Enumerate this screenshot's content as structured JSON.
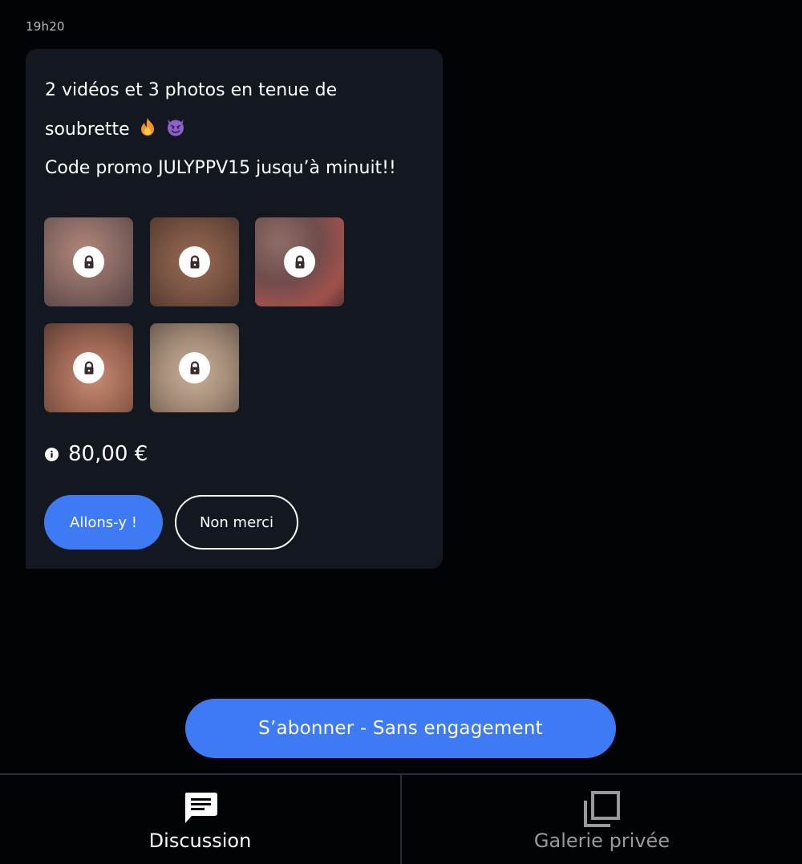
{
  "chat": {
    "timestamp": "19h20",
    "message": {
      "line1": "2 vidéos et 3 photos en tenue de",
      "line2": "soubrette",
      "line3": "Code promo JULYPPV15 jusqu’à minuit!!",
      "emojis": [
        "fire-emoji",
        "smiling-devil-emoji"
      ]
    },
    "locked_media": [
      {
        "icon": "lock-icon"
      },
      {
        "icon": "lock-icon"
      },
      {
        "icon": "lock-icon"
      },
      {
        "icon": "lock-icon"
      },
      {
        "icon": "lock-icon"
      }
    ],
    "price": "80,00 €",
    "price_icon": "info-icon",
    "accept_label": "Allons-y !",
    "decline_label": "Non merci"
  },
  "subscribe_label": "S’abonner - Sans engagement",
  "tabs": [
    {
      "label": "Discussion",
      "icon": "chat-bubble-icon",
      "active": true
    },
    {
      "label": "Galerie privée",
      "icon": "gallery-stack-icon",
      "active": false
    }
  ],
  "colors": {
    "background": "#020307",
    "bubble": "#131720",
    "accent": "#3f7af5",
    "inactive_tab": "#9a9a9a"
  }
}
